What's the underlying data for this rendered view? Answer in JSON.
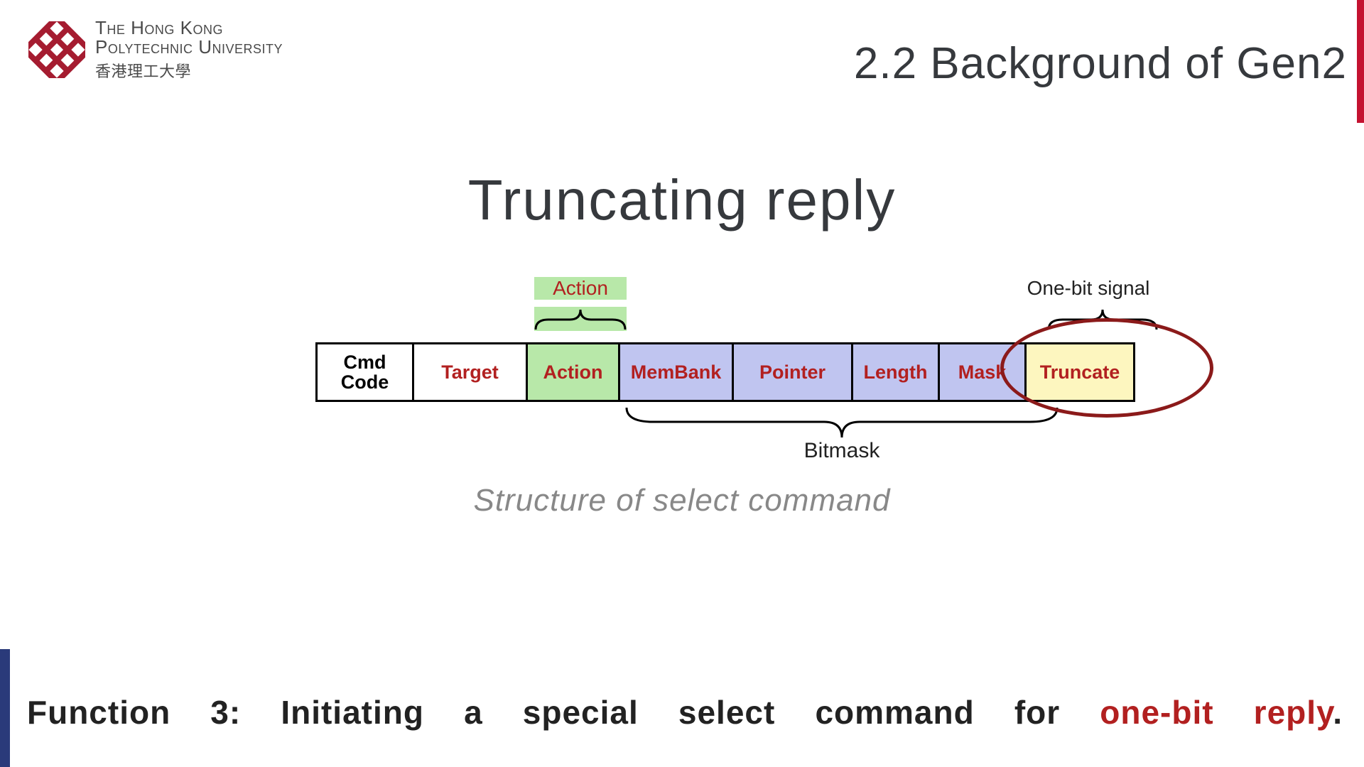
{
  "logo": {
    "line1": "The Hong Kong",
    "line2": "Polytechnic University",
    "line3": "香港理工大學"
  },
  "section_title": "2.2 Background of Gen2",
  "main_heading": "Truncating  reply",
  "diagram": {
    "top_labels": {
      "action": "Action",
      "onebit": "One-bit signal"
    },
    "fields": {
      "cmd": "Cmd\nCode",
      "target": "Target",
      "action": "Action",
      "membank": "MemBank",
      "pointer": "Pointer",
      "length": "Length",
      "mask": "Mask",
      "truncate": "Truncate"
    },
    "bottom_label": "Bitmask",
    "caption": "Structure  of  select  command"
  },
  "footer": {
    "prefix": "Function  3:  Initiating  a  special  select  command  for  ",
    "highlight": "one-bit  reply",
    "suffix": "."
  }
}
